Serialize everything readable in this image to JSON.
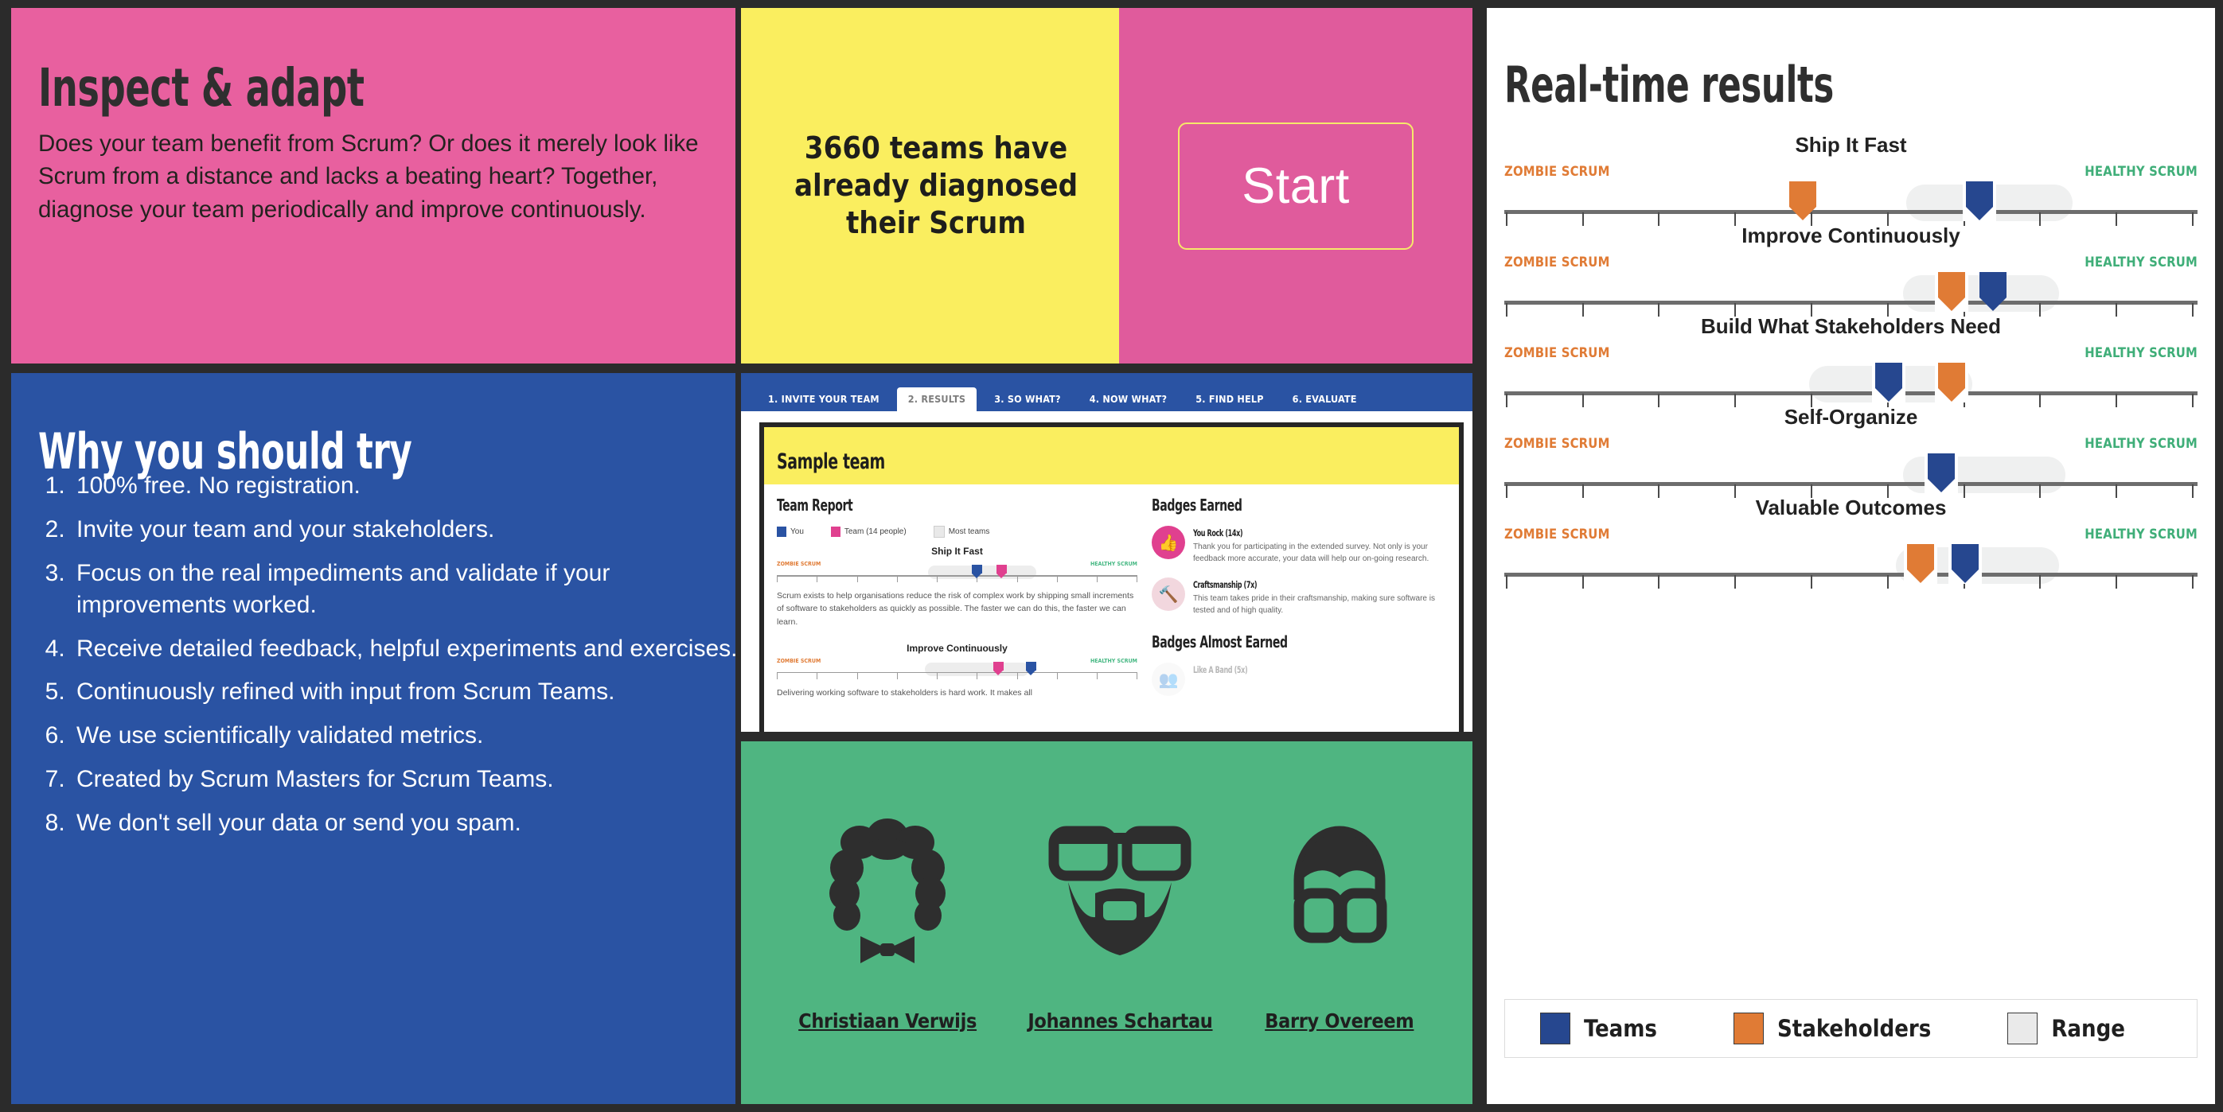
{
  "inspect": {
    "title": "Inspect & adapt",
    "body": "Does your team benefit from Scrum? Or does it merely look like Scrum from a distance and lacks a beating heart? Together, diagnose your team periodically and improve continuously.",
    "bg": "#e8609f"
  },
  "counter": {
    "text": "3660 teams have already diagnosed their Scrum",
    "count": "3660",
    "bg": "#faee5f"
  },
  "start": {
    "label": "Start",
    "bg": "#e05b9c",
    "border": "#f6e96a"
  },
  "why": {
    "title": "Why you should try",
    "bg": "#2a53a3",
    "items": [
      "100% free. No registration.",
      "Invite your team and your stakeholders.",
      "Focus on the real impediments and validate if your improvements worked.",
      "Receive detailed feedback, helpful experiments and exercises.",
      "Continuously refined with input from Scrum Teams.",
      "We use scientifically validated metrics.",
      "Created by Scrum Masters for Scrum Teams.",
      "We don't sell your data or send you spam."
    ]
  },
  "screenshot": {
    "tabs": [
      {
        "label": "1. INVITE YOUR TEAM",
        "active": false
      },
      {
        "label": "2. RESULTS",
        "active": true
      },
      {
        "label": "3. SO WHAT?",
        "active": false
      },
      {
        "label": "4. NOW WHAT?",
        "active": false
      },
      {
        "label": "5. FIND HELP",
        "active": false
      },
      {
        "label": "6. EVALUATE",
        "active": false
      }
    ],
    "team_name": "Sample team",
    "left_heading": "Team Report",
    "right_heading": "Badges Earned",
    "legend": [
      {
        "label": "You",
        "color": "#2a53a3"
      },
      {
        "label": "Team (14 people)",
        "color": "#e0408f"
      },
      {
        "label": "Most teams",
        "color": "#e9e9e9"
      }
    ],
    "charts": [
      {
        "title": "Ship It Fast",
        "zombie": "ZOMBIE SCRUM",
        "healthy": "HEALTHY SCRUM",
        "range": [
          43,
          72
        ],
        "you": 56,
        "team": 62,
        "description": "Scrum exists to help organisations reduce the risk of complex work by shipping small increments of software to stakeholders as quickly as possible. The faster we can do this, the faster we can learn."
      },
      {
        "title": "Improve Continuously",
        "zombie": "ZOMBIE SCRUM",
        "healthy": "HEALTHY SCRUM",
        "range": [
          42,
          70
        ],
        "you": 70,
        "team": 61,
        "description": "Delivering working software to stakeholders is hard work. It makes all"
      }
    ],
    "badges_earned": [
      {
        "title": "You Rock (14x)",
        "description": "Thank you for participating in the extended survey. Not only is your feedback more accurate, your data will help our on-going research.",
        "icon": "thumbs-up-icon",
        "color": "#e0408f"
      },
      {
        "title": "Craftsmanship (7x)",
        "description": "This team takes pride in their craftsmanship, making sure software is tested and of high quality.",
        "icon": "hammer-icon",
        "color": "#f2d7de"
      }
    ],
    "badges_almost_heading": "Badges Almost Earned",
    "badges_almost": [
      {
        "title": "Like A Band (5x)",
        "icon": "add-person-icon",
        "color": "#f2f2f2"
      }
    ]
  },
  "authors": {
    "bg": "#4fb581",
    "people": [
      {
        "name": "Christiaan Verwijs",
        "avatar": "curly-hair-bowtie-avatar"
      },
      {
        "name": "Johannes Schartau",
        "avatar": "glasses-beard-avatar"
      },
      {
        "name": "Barry Overeem",
        "avatar": "short-hair-glasses-avatar"
      }
    ]
  },
  "results": {
    "title": "Real-time results",
    "zombie_label": "ZOMBIE SCRUM",
    "healthy_label": "HEALTHY SCRUM",
    "colors": {
      "teams": "#26478f",
      "stakeholders": "#e07b35",
      "range": "#eff0f0",
      "axis": "#6d6d6d",
      "zombie_text": "#e07b35",
      "healthy_text": "#3fae78"
    },
    "legend": [
      {
        "label": "Teams",
        "color": "#26478f",
        "name": "teams"
      },
      {
        "label": "Stakeholders",
        "color": "#e07b35",
        "name": "stakeholders"
      },
      {
        "label": "Range",
        "color": "#eaeaea",
        "name": "range"
      }
    ]
  },
  "chart_data": {
    "type": "bar",
    "title": "Real-time results",
    "xlabel": "",
    "ylabel": "",
    "xlim": [
      0,
      100
    ],
    "axis_ticks": 10,
    "grid": false,
    "legend_position": "bottom",
    "left_axis_label": "ZOMBIE SCRUM",
    "right_axis_label": "HEALTHY SCRUM",
    "categories": [
      "Ship It Fast",
      "Improve Continuously",
      "Build What Stakeholders Need",
      "Self-Organize",
      "Valuable Outcomes"
    ],
    "series": [
      {
        "name": "Teams",
        "color": "#26478f",
        "values": [
          68.5,
          70.5,
          55.5,
          63.0,
          66.5
        ]
      },
      {
        "name": "Stakeholders",
        "color": "#e07b35",
        "values": [
          43.0,
          64.5,
          64.5,
          null,
          60.0
        ]
      }
    ],
    "ranges": [
      {
        "category": "Ship It Fast",
        "start": 58.0,
        "end": 82.0
      },
      {
        "category": "Improve Continuously",
        "start": 57.5,
        "end": 80.0
      },
      {
        "category": "Build What Stakeholders Need",
        "start": 44.0,
        "end": 73.0
      },
      {
        "category": "Self-Organize",
        "start": 57.5,
        "end": 81.0
      },
      {
        "category": "Valuable Outcomes",
        "start": 56.5,
        "end": 80.0
      }
    ]
  }
}
